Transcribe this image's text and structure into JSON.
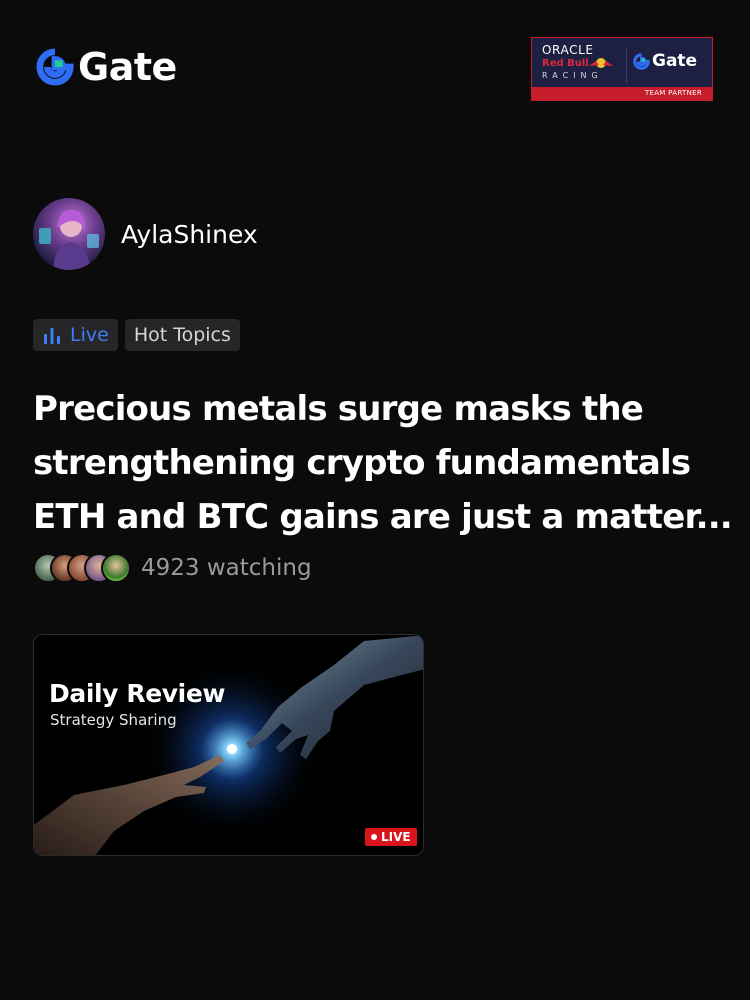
{
  "brand": {
    "logo_text": "Gate",
    "accent_color": "#2f6df6",
    "green_color": "#1ecf8e"
  },
  "partner_banner": {
    "oracle": "ORACLE",
    "redbull": "Red Bull",
    "racing": "RACING",
    "gate": "Gate",
    "team_partner": "TEAM PARTNER"
  },
  "author": {
    "name": "AylaShinex",
    "avatar_icon": "avatar-image"
  },
  "tags": {
    "live_label": "Live",
    "live_icon": "bars-chart-icon",
    "topic_label": "Hot Topics"
  },
  "post": {
    "title": "Precious metals surge masks the strengthening crypto fundamentals ETH and BTC gains are just a matter..."
  },
  "watchers": {
    "text": "4923 watching"
  },
  "video_card": {
    "title": "Daily Review",
    "subtitle": "Strategy Sharing",
    "live_badge": "LIVE"
  }
}
